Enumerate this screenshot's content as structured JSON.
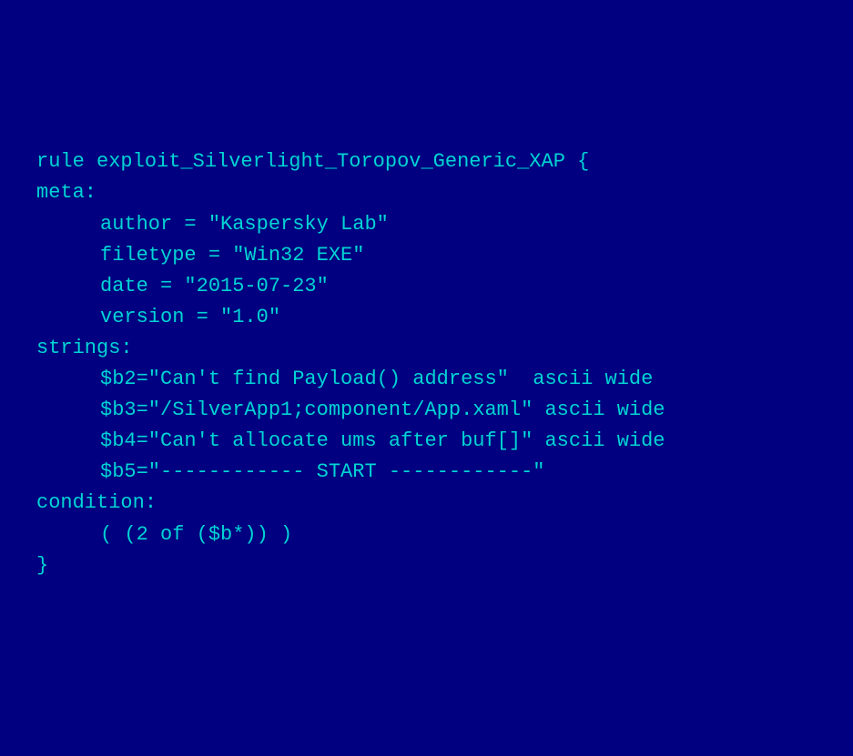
{
  "code": {
    "line1": "rule exploit_Silverlight_Toropov_Generic_XAP {",
    "line2": "",
    "line3": "meta:",
    "line4": "",
    "line5": "author = \"Kaspersky Lab\"",
    "line6": "filetype = \"Win32 EXE\"",
    "line7": "date = \"2015-07-23\"",
    "line8": "version = \"1.0\"",
    "line9": "",
    "line10": "strings:",
    "line11": "",
    "line12": "",
    "line13": "$b2=\"Can't find Payload() address\"  ascii wide",
    "line14": "$b3=\"/SilverApp1;component/App.xaml\" ascii wide",
    "line15": "$b4=\"Can't allocate ums after buf[]\" ascii wide",
    "line16": "$b5=\"------------ START ------------\"",
    "line17": "",
    "line18": "condition:",
    "line19": "",
    "line20": "( (2 of ($b*)) )",
    "line21": "",
    "line22": "}"
  }
}
